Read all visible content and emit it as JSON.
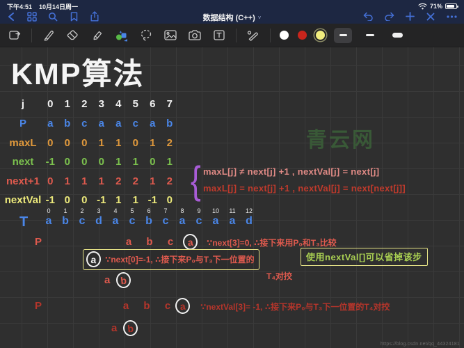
{
  "status_bar": {
    "time": "下午4:51",
    "date": "10月14日周一",
    "battery_percent": "71%"
  },
  "nav_bar": {
    "title": "数据结构 (C++)",
    "caret": "˅",
    "icon_color": "#4470d6",
    "left_icons": [
      "back",
      "grid-view",
      "search",
      "bookmark",
      "share"
    ],
    "right_icons": [
      "undo",
      "redo",
      "add-page",
      "close",
      "more"
    ]
  },
  "toolbar": {
    "icon_color": "#c9c9c9",
    "tools": [
      "page-template",
      "pen",
      "eraser",
      "highlighter",
      "shapes",
      "lasso",
      "image",
      "camera",
      "text",
      "laser-pointer"
    ],
    "ink_colors": [
      "#ffffff",
      "#c9251c",
      "#f0ec7e"
    ],
    "selected_ink_color": "#f0ec7e",
    "stroke_widths": [
      "thin",
      "medium",
      "thick"
    ],
    "selected_stroke_width": "thin"
  },
  "canvas": {
    "title": "KMP算法",
    "table": {
      "rows": [
        {
          "label": "j",
          "color": "#f2f2f2",
          "values": [
            "0",
            "1",
            "2",
            "3",
            "4",
            "5",
            "6",
            "7"
          ]
        },
        {
          "label": "P",
          "color": "#4a86e8",
          "values": [
            "a",
            "b",
            "c",
            "a",
            "a",
            "c",
            "a",
            "b"
          ]
        },
        {
          "label": "maxL",
          "color": "#e0993c",
          "values": [
            "0",
            "0",
            "0",
            "1",
            "1",
            "0",
            "1",
            "2"
          ]
        },
        {
          "label": "next",
          "color": "#7cc24e",
          "values": [
            "-1",
            "0",
            "0",
            "0",
            "1",
            "1",
            "0",
            "1"
          ]
        },
        {
          "label": "next+1",
          "color": "#df5a4e",
          "values": [
            "0",
            "1",
            "1",
            "1",
            "2",
            "2",
            "1",
            "2"
          ]
        },
        {
          "label": "nextVal",
          "color": "#ece97b",
          "values": [
            "-1",
            "0",
            "0",
            "-1",
            "1",
            "1",
            "-1",
            "0"
          ]
        }
      ]
    },
    "brace": {
      "glyph": "{",
      "color": "#a85cd6"
    },
    "formulas": [
      {
        "text": "maxL[j] ≠ next[j] +1 , nextVal[j] = next[j]",
        "color": "#e08a85"
      },
      {
        "text": "maxL[j] = next[j] +1 , nextVal[j] = next[next[j]]",
        "color": "#bf3a2c"
      }
    ],
    "t_row": {
      "label": "T",
      "color": "#4a86e8",
      "indices": [
        "0",
        "1",
        "2",
        "3",
        "4",
        "5",
        "6",
        "7",
        "8",
        "9",
        "10",
        "11",
        "12"
      ],
      "letters": [
        "a",
        "b",
        "c",
        "d",
        "a",
        "c",
        "b",
        "c",
        "a",
        "c",
        "a",
        "a",
        "d"
      ]
    },
    "match1": {
      "p_label": "P",
      "letters": [
        "a",
        "b",
        "c"
      ],
      "circled_letter": "a",
      "note": "∵next[3]=0, ∴接下来用P₀和T₃比较",
      "color": "#df5a4e"
    },
    "match1b": {
      "circled_letter": "a",
      "note": "∵next[0]=-1, ∴接下来P₀与T₃下一位置的",
      "note2": "T₄对挍",
      "sub_letter": "a",
      "sub_circled": "b",
      "color": "#df5a4e"
    },
    "green_note": {
      "text": "使用nextVal[]可以省掉该步",
      "color": "#a9cf52"
    },
    "match2": {
      "p_label": "P",
      "letters": [
        "a",
        "b",
        "c"
      ],
      "circled_letter": "a",
      "note": "∵nextVal[3]= -1, ∴接下来P₀与T₃下一位置的T₄对挍",
      "sub_letter": "a",
      "sub_circled": "b",
      "color": "#b5352b"
    },
    "watermark": {
      "text": "青云网",
      "color": "#3a5c38"
    },
    "url": "https://blog.csdn.net/qq_44324181"
  }
}
